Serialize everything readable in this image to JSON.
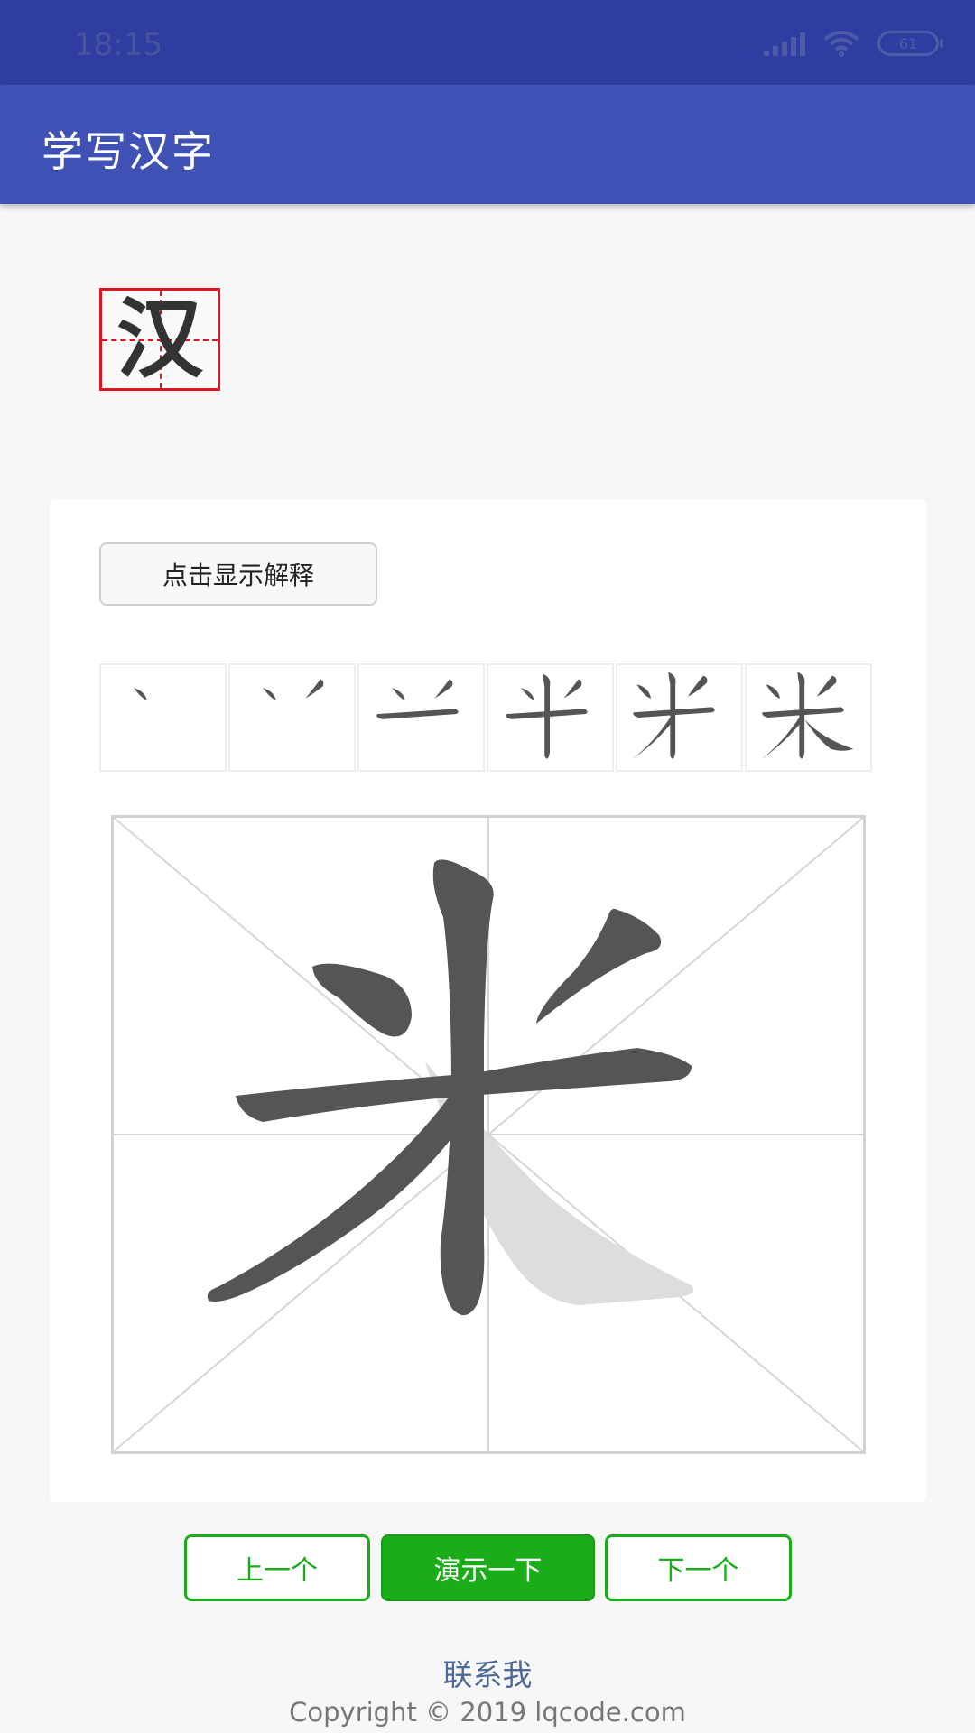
{
  "status_bar": {
    "time": "18:15",
    "battery": "61",
    "icons": [
      "signal-icon",
      "wifi-icon",
      "battery-icon"
    ]
  },
  "app_bar": {
    "title": "学写汉字"
  },
  "current_character": {
    "char": "汉",
    "border_color": "#e0141e"
  },
  "card": {
    "explain_button_label": "点击显示解释",
    "stroke_order_count": 6,
    "practice_character": "米",
    "practice_completed_strokes": 5,
    "practice_total_strokes": 6
  },
  "controls": {
    "prev_label": "上一个",
    "demo_label": "演示一下",
    "next_label": "下一个",
    "accent_color": "#1aad19"
  },
  "footer": {
    "contact_label": "联系我",
    "copyright": "Copyright © 2019 lqcode.com"
  },
  "colors": {
    "status_bar": "#2e3d9f",
    "app_bar": "#3f51b5",
    "stroke": "#555555",
    "ghost_stroke": "#dddddd"
  }
}
